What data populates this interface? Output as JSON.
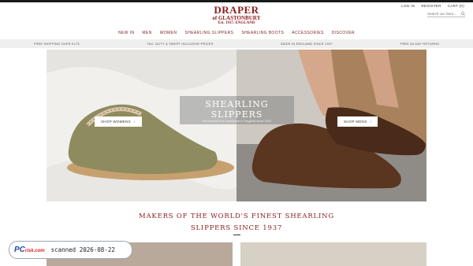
{
  "logo": {
    "line1": "DRAPER",
    "line2": "of GLASTONBURY",
    "line3": "Est. 1937. ENGLAND"
  },
  "utility": {
    "login": "LOG IN",
    "register": "REGISTER",
    "cart": "CART (0)"
  },
  "search": {
    "placeholder": "Search our store..."
  },
  "nav": [
    "NEW IN",
    "MEN",
    "WOMEN",
    "SHEARLING SLIPPERS",
    "SHEARLING BOOTS",
    "ACCESSORIES",
    "DISCOVER"
  ],
  "strip": [
    "FREE SHIPPING OVER £175",
    "TAX, DUTY & TARIFF INCLUSIVE PRICES",
    "MADE IN ENGLAND SINCE 1937",
    "FREE 60-DAY RETURNS"
  ],
  "hero": {
    "title": "SHEARLING SLIPPERS",
    "subtitle": "Handmade from sheepskin in England since 1937",
    "shop_women": "SHOP WOMENS",
    "shop_men": "SHOP MENS"
  },
  "headline": {
    "line1": "MAKERS OF THE WORLD'S FINEST SHEARLING",
    "line2": "SLIPPERS SINCE 1937"
  },
  "watermark": {
    "brand": "PC",
    "brand_suffix": "risk.com",
    "stamp": "scanned 2026-08-22"
  },
  "colors": {
    "brand": "#8a1c1c",
    "strip_bg": "#efefef"
  }
}
